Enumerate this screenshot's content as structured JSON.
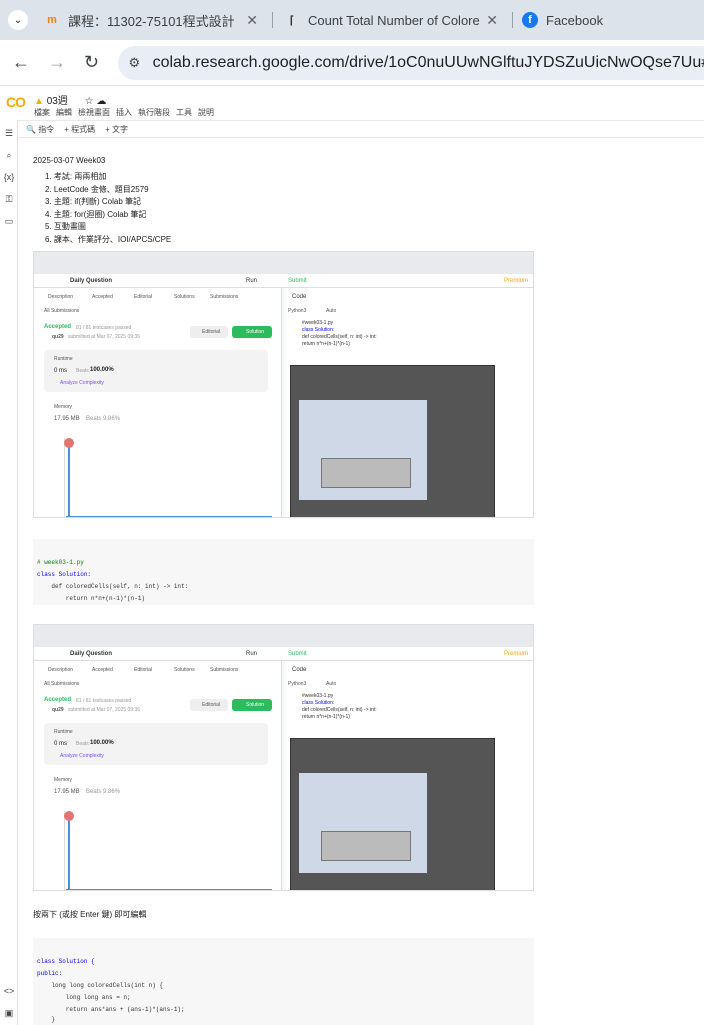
{
  "browser": {
    "tabs": [
      {
        "title": "課程：11302-75101程式設計（",
        "icon": "moodle-icon"
      },
      {
        "title": "Count Total Number of Colore",
        "icon": "leetcode-icon"
      },
      {
        "title": "Facebook",
        "icon": "facebook-icon"
      }
    ],
    "url": "colab.research.google.com/drive/1oC0nuUUwNGlftuJYDSZuUicNwOQse7Uu#scrollT"
  },
  "colab": {
    "logo": "CO",
    "title": "03週",
    "menu": [
      "檔案",
      "編輯",
      "檢視畫面",
      "插入",
      "執行階段",
      "工具",
      "說明"
    ],
    "cmd": [
      "指令",
      "+ 程式碼",
      "+ 文字"
    ]
  },
  "cell1": {
    "date": "2025-03-07 Week03",
    "items": [
      "1. 考試: 兩兩相加",
      "2. LeetCode 金條、題目2579",
      "3. 主題: if(判斷) Colab 筆記",
      "4. 主題: for(迴圈) Colab 筆記",
      "5. 互動畫圖",
      "6. 課本、作業評分、IOI/APCS/CPE"
    ]
  },
  "shot": {
    "header": "Daily Question",
    "tabs": [
      "Description",
      "Accepted",
      "Editorial",
      "Solutions",
      "Submissions"
    ],
    "all_submissions": "All Submissions",
    "accepted": "Accepted",
    "passed": "81 / 81 testcases passed",
    "user": "qu29",
    "submitted": "submitted at Mar 07, 2025 09:36",
    "editorial_btn": "Editorial",
    "solution_btn": "Solution",
    "runtime_label": "Runtime",
    "runtime_val": "0 ms",
    "beats": "Beats",
    "beats_pct": "100.00%",
    "analyze": "Analyze Complexity",
    "memory_label": "Memory",
    "memory_val": "17.95 MB",
    "memory_beats": "Beats 9.86%",
    "code_label": "Code",
    "lang": "Python3",
    "auto": "Auto",
    "run": "Run",
    "submit": "Submit",
    "premium": "Premium",
    "code_lines": [
      "#week03-1.py",
      "class Solution:",
      "    def coloredCells(self, n: int) -> int:",
      "        return n*n+(n-1)*(n-1)"
    ]
  },
  "code1": {
    "lines": [
      "# week03-1.py",
      "class Solution:",
      "    def coloredCells(self, n: int) -> int:",
      "        return n*n+(n-1)*(n-1)"
    ]
  },
  "hint": "按兩下 (或按 Enter 鍵) 即可編輯",
  "code2": {
    "lines": [
      "class Solution {",
      "public:",
      "    long long coloredCells(int n) {",
      "        long long ans = n;",
      "        return ans*ans + (ans-1)*(ans-1);",
      "    }"
    ]
  }
}
